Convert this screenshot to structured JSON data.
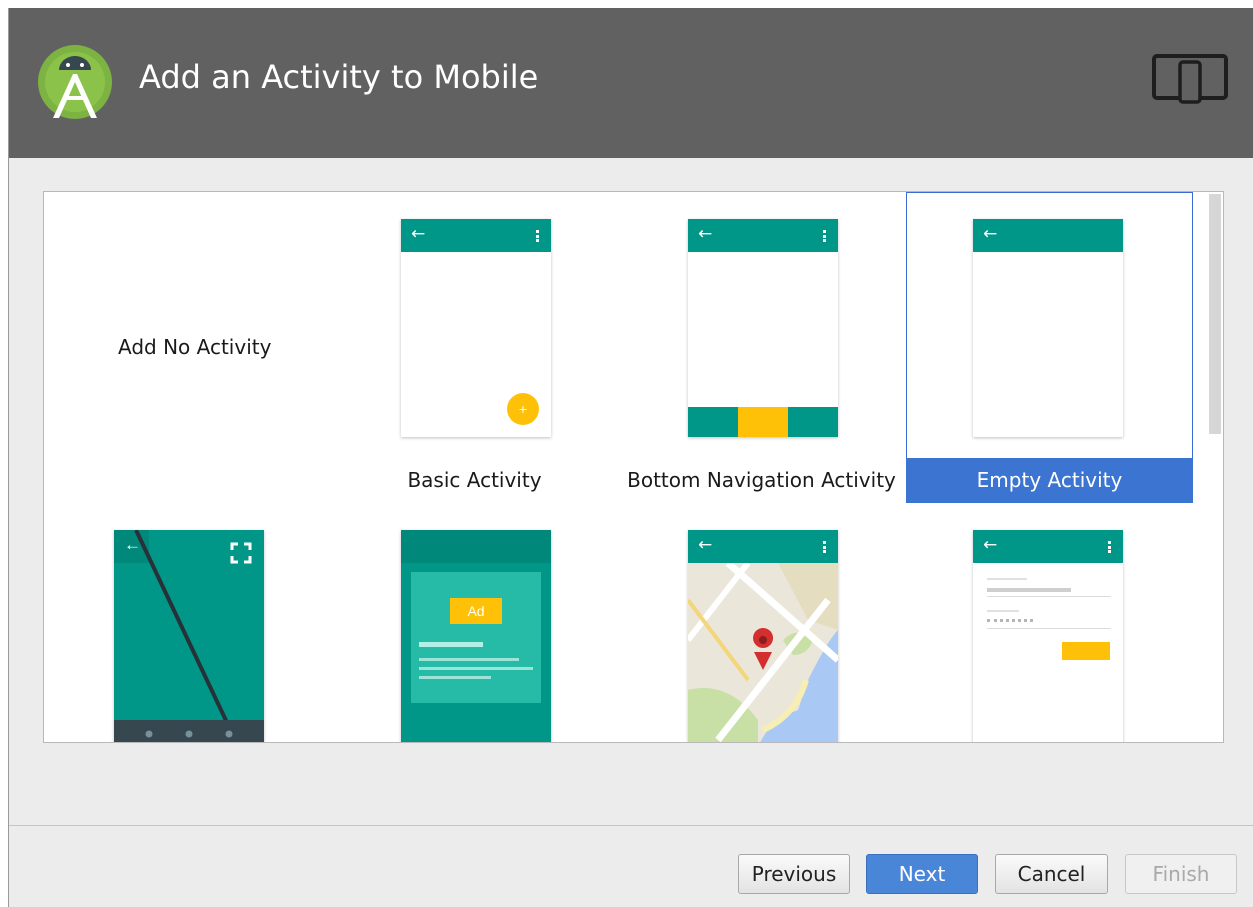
{
  "window": {
    "title": "Add an Activity to Mobile"
  },
  "icons": {
    "logo": "android-studio-logo-icon",
    "device": "phone-tablet-device-icon"
  },
  "gallery": {
    "tiles": [
      {
        "label": "Add No Activity"
      },
      {
        "label": "Basic Activity"
      },
      {
        "label": "Bottom Navigation Activity"
      },
      {
        "label": "Empty Activity",
        "selected": true
      },
      {
        "label": ""
      },
      {
        "label": ""
      },
      {
        "label": ""
      },
      {
        "label": ""
      }
    ],
    "ad_label": "Ad"
  },
  "buttons": {
    "previous": "Previous",
    "next": "Next",
    "cancel": "Cancel",
    "finish": "Finish"
  },
  "colors": {
    "header": "#616161",
    "teal": "#009688",
    "selection": "#3b74d1",
    "accent": "#ffc107"
  }
}
